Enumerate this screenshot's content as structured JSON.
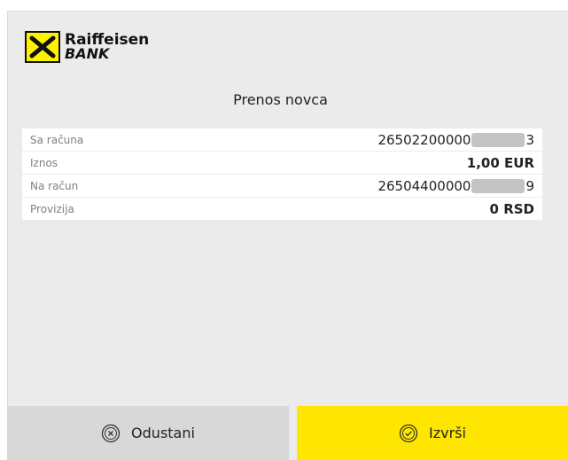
{
  "brand": {
    "name": "Raiffeisen",
    "sub": "BANK"
  },
  "title": "Prenos novca",
  "details": [
    {
      "label": "Sa računa",
      "value_prefix": "26502200000",
      "value_suffix": "3",
      "masked": true
    },
    {
      "label": "Iznos",
      "value": "1,00 EUR",
      "masked": false
    },
    {
      "label": "Na račun",
      "value_prefix": "26504400000",
      "value_suffix": "9",
      "masked": true
    },
    {
      "label": "Provizija",
      "value": "0 RSD",
      "masked": false
    }
  ],
  "actions": {
    "cancel_label": "Odustani",
    "cancel_icon": "x-circle-icon",
    "confirm_label": "Izvrši",
    "confirm_icon": "check-circle-icon"
  },
  "colors": {
    "brand_yellow": "#ffe600",
    "panel_bg": "#ebebeb",
    "cancel_bg": "#d8d8d8"
  }
}
